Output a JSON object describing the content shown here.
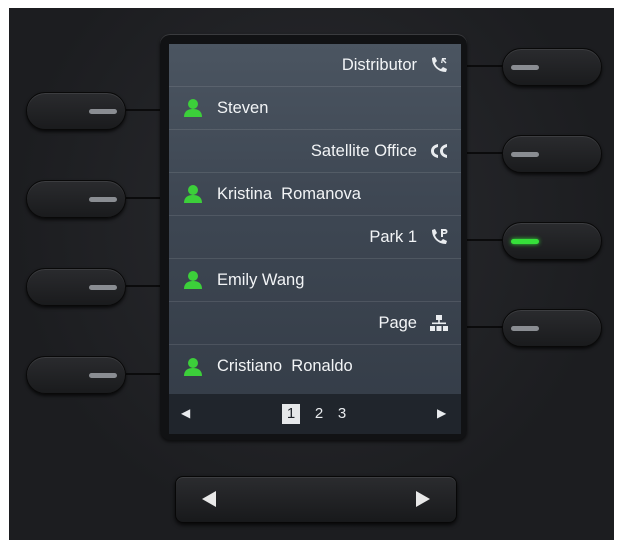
{
  "screen": {
    "rows": [
      {
        "label": "Distributor",
        "side": "right",
        "icon": "distributor-call-icon"
      },
      {
        "label": "Steven",
        "side": "left",
        "icon": "person-icon"
      },
      {
        "label": "Satellite Office",
        "side": "right",
        "icon": "satellite-office-icon"
      },
      {
        "label": "Kristina  Romanova",
        "side": "left",
        "icon": "person-icon"
      },
      {
        "label": "Park 1",
        "side": "right",
        "icon": "park-call-icon"
      },
      {
        "label": "Emily Wang",
        "side": "left",
        "icon": "person-icon"
      },
      {
        "label": "Page",
        "side": "right",
        "icon": "paging-tree-icon"
      },
      {
        "label": "Cristiano  Ronaldo",
        "side": "left",
        "icon": "person-icon"
      }
    ],
    "pager": {
      "prev": "◀",
      "next": "▶",
      "pages": [
        "1",
        "2",
        "3"
      ],
      "active_page": "1"
    }
  },
  "keys": {
    "left_led_states": [
      "off",
      "off",
      "off",
      "off"
    ],
    "right_led_states": [
      "off",
      "off",
      "on",
      "off"
    ]
  },
  "colors": {
    "presence_green": "#3ccf3a",
    "led_on": "#36e03a",
    "led_off": "#8a8d92"
  },
  "nav": {
    "prev_icon": "triangle-left-icon",
    "next_icon": "triangle-right-icon"
  }
}
